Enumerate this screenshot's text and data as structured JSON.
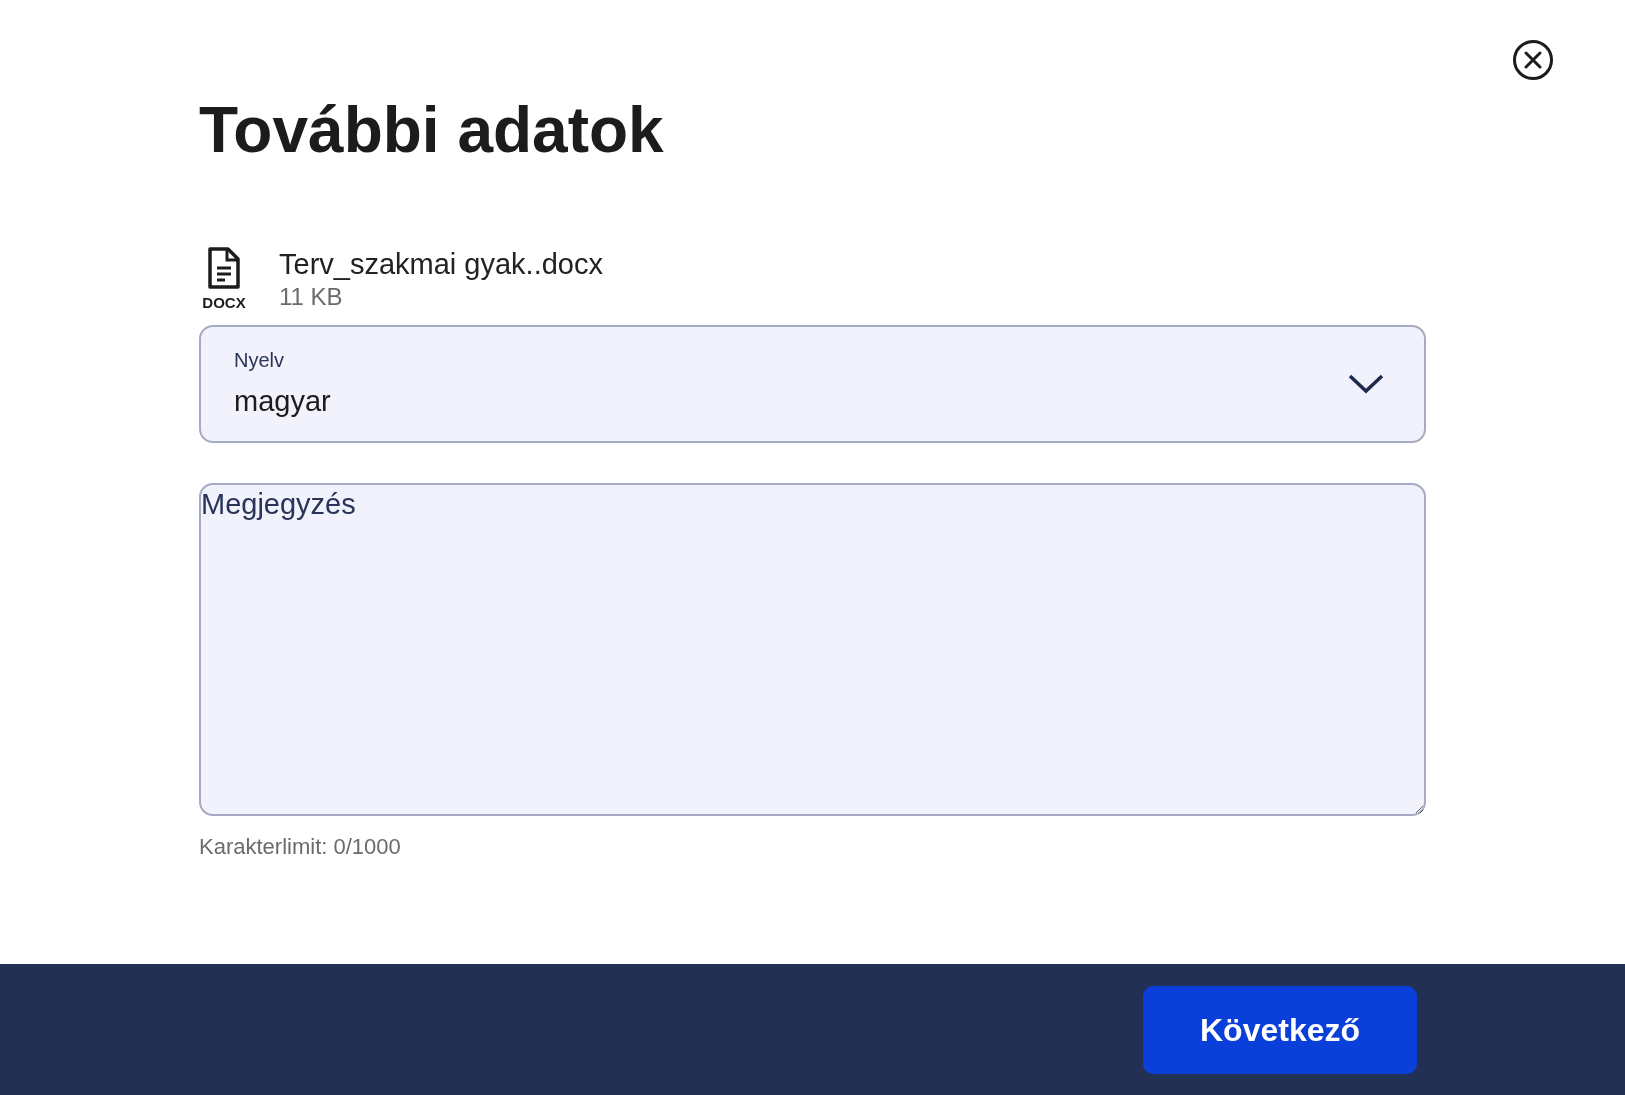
{
  "dialog": {
    "title": "További adatok"
  },
  "file": {
    "name": "Terv_szakmai gyak..docx",
    "size": "11 KB",
    "type_label": "DOCX"
  },
  "language_select": {
    "label": "Nyelv",
    "value": "magyar"
  },
  "note": {
    "placeholder": "Megjegyzés",
    "char_limit": "Karakterlimit: 0/1000"
  },
  "footer": {
    "next_button": "Következő"
  }
}
